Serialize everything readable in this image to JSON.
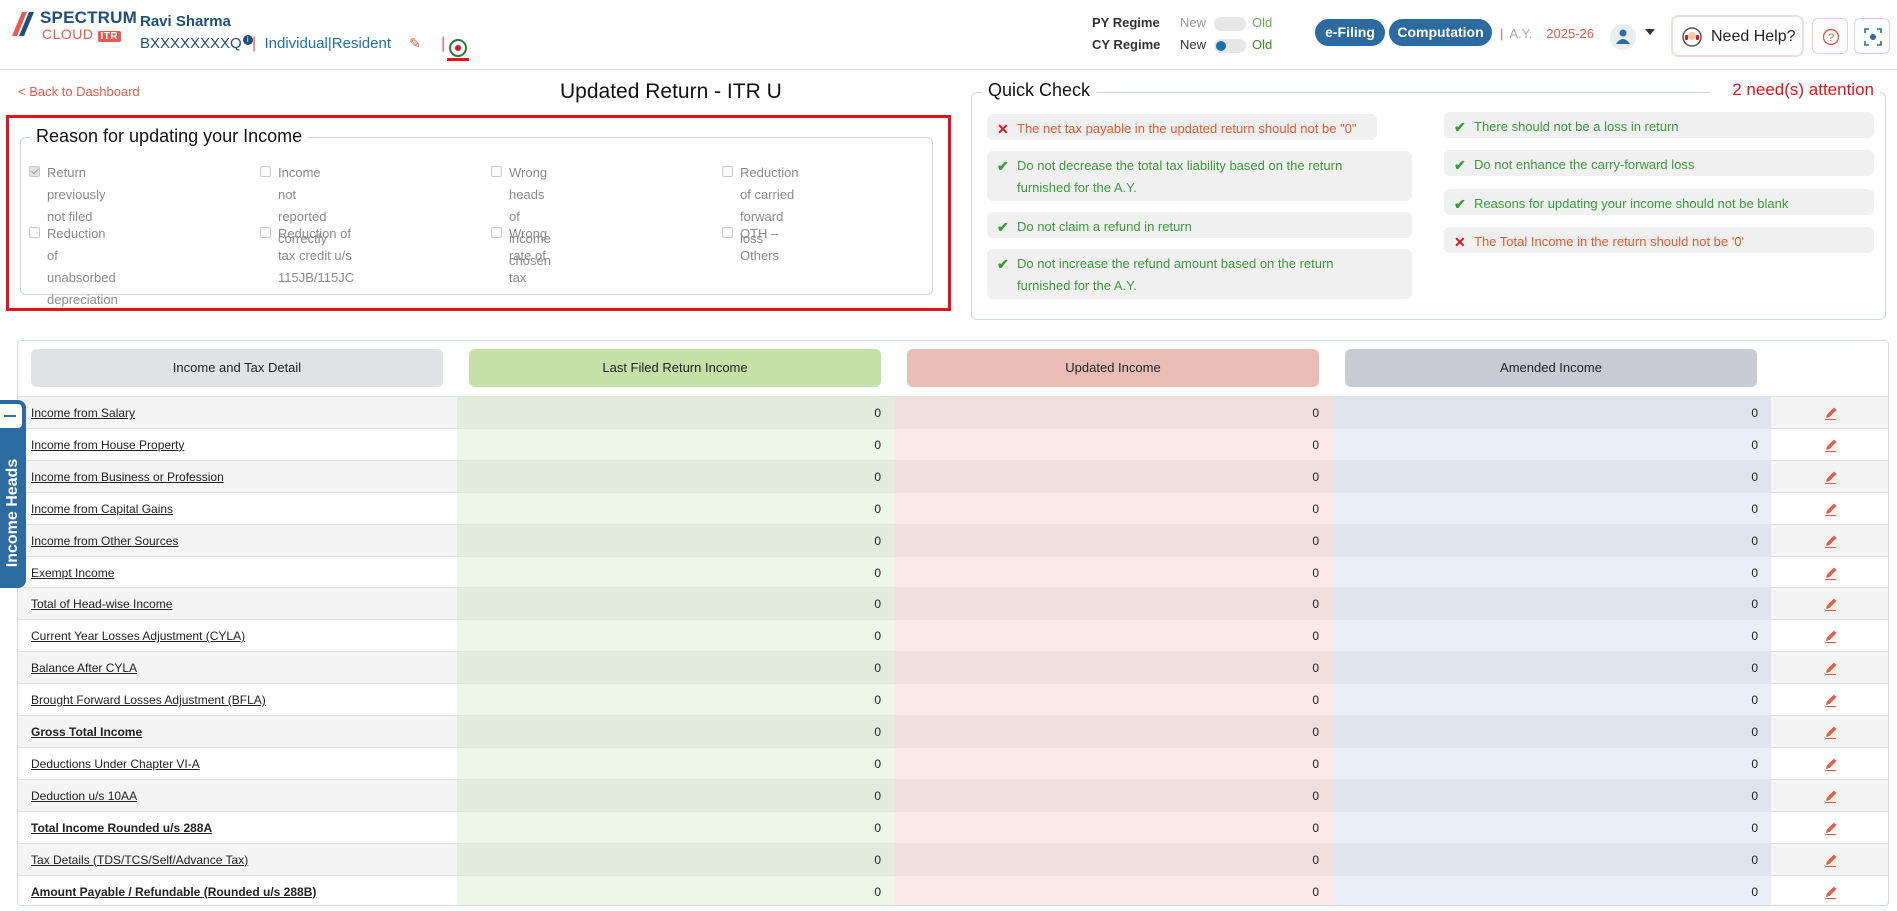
{
  "brand": {
    "name": "SPECTRUM",
    "sub": "CLOUD",
    "badge": "ITR"
  },
  "user": {
    "name": "Ravi Sharma",
    "pan": "BXXXXXXXXQ",
    "type": "Individual",
    "residency": "Resident",
    "divider": "|"
  },
  "regime": {
    "py": {
      "label": "PY Regime",
      "new": "New",
      "old": "Old"
    },
    "cy": {
      "label": "CY Regime",
      "new": "New",
      "old": "Old"
    }
  },
  "nav": {
    "efiling": "e-Filing",
    "computation": "Computation",
    "ay_label": "A.Y.",
    "ay_value": "2025-26",
    "help": "Need Help?"
  },
  "page": {
    "back": "< Back to Dashboard",
    "title": "Updated Return - ITR U"
  },
  "reason": {
    "legend": "Reason for updating your Income",
    "options": [
      {
        "label": "Return previously not filed",
        "checked": true
      },
      {
        "label": "Income not reported correctly",
        "checked": false
      },
      {
        "label": "Wrong heads of income chosen",
        "checked": false
      },
      {
        "label": "Reduction of carried forward",
        "label2": "loss",
        "checked": false
      },
      {
        "label": "Reduction of unabsorbed",
        "label2": "depreciation",
        "checked": false
      },
      {
        "label": "Reduction of tax credit u/s",
        "label2": "115JB/115JC",
        "checked": false
      },
      {
        "label": "Wrong rate of tax",
        "checked": false
      },
      {
        "label": "OTH – Others",
        "checked": false
      }
    ]
  },
  "quick_check": {
    "legend": "Quick Check",
    "attention": "2 need(s) attention",
    "left": [
      {
        "text": "The net tax payable in the updated return should not be \"0\"",
        "status": "fail"
      },
      {
        "text": "Do not decrease the total tax liability based on the return",
        "text2": "furnished for the A.Y.",
        "status": "pass"
      },
      {
        "text": "Do not claim a refund in return",
        "status": "pass"
      },
      {
        "text": "Do not increase the refund amount based on the return",
        "text2": "furnished for the A.Y.",
        "status": "pass"
      }
    ],
    "right": [
      {
        "text": "There should not be a loss in return",
        "status": "pass"
      },
      {
        "text": "Do not enhance the carry-forward loss",
        "status": "pass"
      },
      {
        "text": "Reasons for updating your income should not be blank",
        "status": "pass"
      },
      {
        "text": "The Total Income in the return should not be '0'",
        "status": "fail"
      }
    ]
  },
  "table": {
    "headers": [
      "Income and Tax Detail",
      "Last Filed Return Income",
      "Updated Income",
      "Amended Income"
    ],
    "rows": [
      {
        "label": "Income from Salary",
        "last": "0",
        "updated": "0",
        "amended": "0",
        "bold": false
      },
      {
        "label": "Income from House Property",
        "last": "0",
        "updated": "0",
        "amended": "0",
        "bold": false
      },
      {
        "label": "Income from Business or Profession",
        "last": "0",
        "updated": "0",
        "amended": "0",
        "bold": false
      },
      {
        "label": "Income from Capital Gains",
        "last": "0",
        "updated": "0",
        "amended": "0",
        "bold": false
      },
      {
        "label": "Income from Other Sources",
        "last": "0",
        "updated": "0",
        "amended": "0",
        "bold": false
      },
      {
        "label": "Exempt Income",
        "last": "0",
        "updated": "0",
        "amended": "0",
        "bold": false
      },
      {
        "label": "Total of Head-wise Income",
        "last": "0",
        "updated": "0",
        "amended": "0",
        "bold": false
      },
      {
        "label": "Current Year Losses Adjustment (CYLA)",
        "last": "0",
        "updated": "0",
        "amended": "0",
        "bold": false
      },
      {
        "label": "Balance After CYLA",
        "last": "0",
        "updated": "0",
        "amended": "0",
        "bold": false
      },
      {
        "label": "Brought Forward Losses Adjustment (BFLA)",
        "last": "0",
        "updated": "0",
        "amended": "0",
        "bold": false
      },
      {
        "label": "Gross Total Income",
        "last": "0",
        "updated": "0",
        "amended": "0",
        "bold": true
      },
      {
        "label": "Deductions Under Chapter VI-A",
        "last": "0",
        "updated": "0",
        "amended": "0",
        "bold": false
      },
      {
        "label": "Deduction u/s 10AA",
        "last": "0",
        "updated": "0",
        "amended": "0",
        "bold": false
      },
      {
        "label": "Total Income Rounded u/s 288A",
        "last": "0",
        "updated": "0",
        "amended": "0",
        "bold": true
      },
      {
        "label": "Tax Details (TDS/TCS/Self/Advance Tax)",
        "last": "0",
        "updated": "0",
        "amended": "0",
        "bold": false
      },
      {
        "label": "Amount Payable / Refundable (Rounded u/s 288B)",
        "last": "0",
        "updated": "0",
        "amended": "0",
        "bold": true
      }
    ]
  },
  "side_tab": "Income Heads",
  "colors": {
    "primary": "#2d6a9f",
    "accent": "#e55b4d",
    "pass": "#3c9a3c",
    "fail": "#e0141e",
    "last_bg": "#c6e1a8",
    "updated_bg": "#e9bcb5",
    "amended_bg": "#c8cbd4"
  }
}
